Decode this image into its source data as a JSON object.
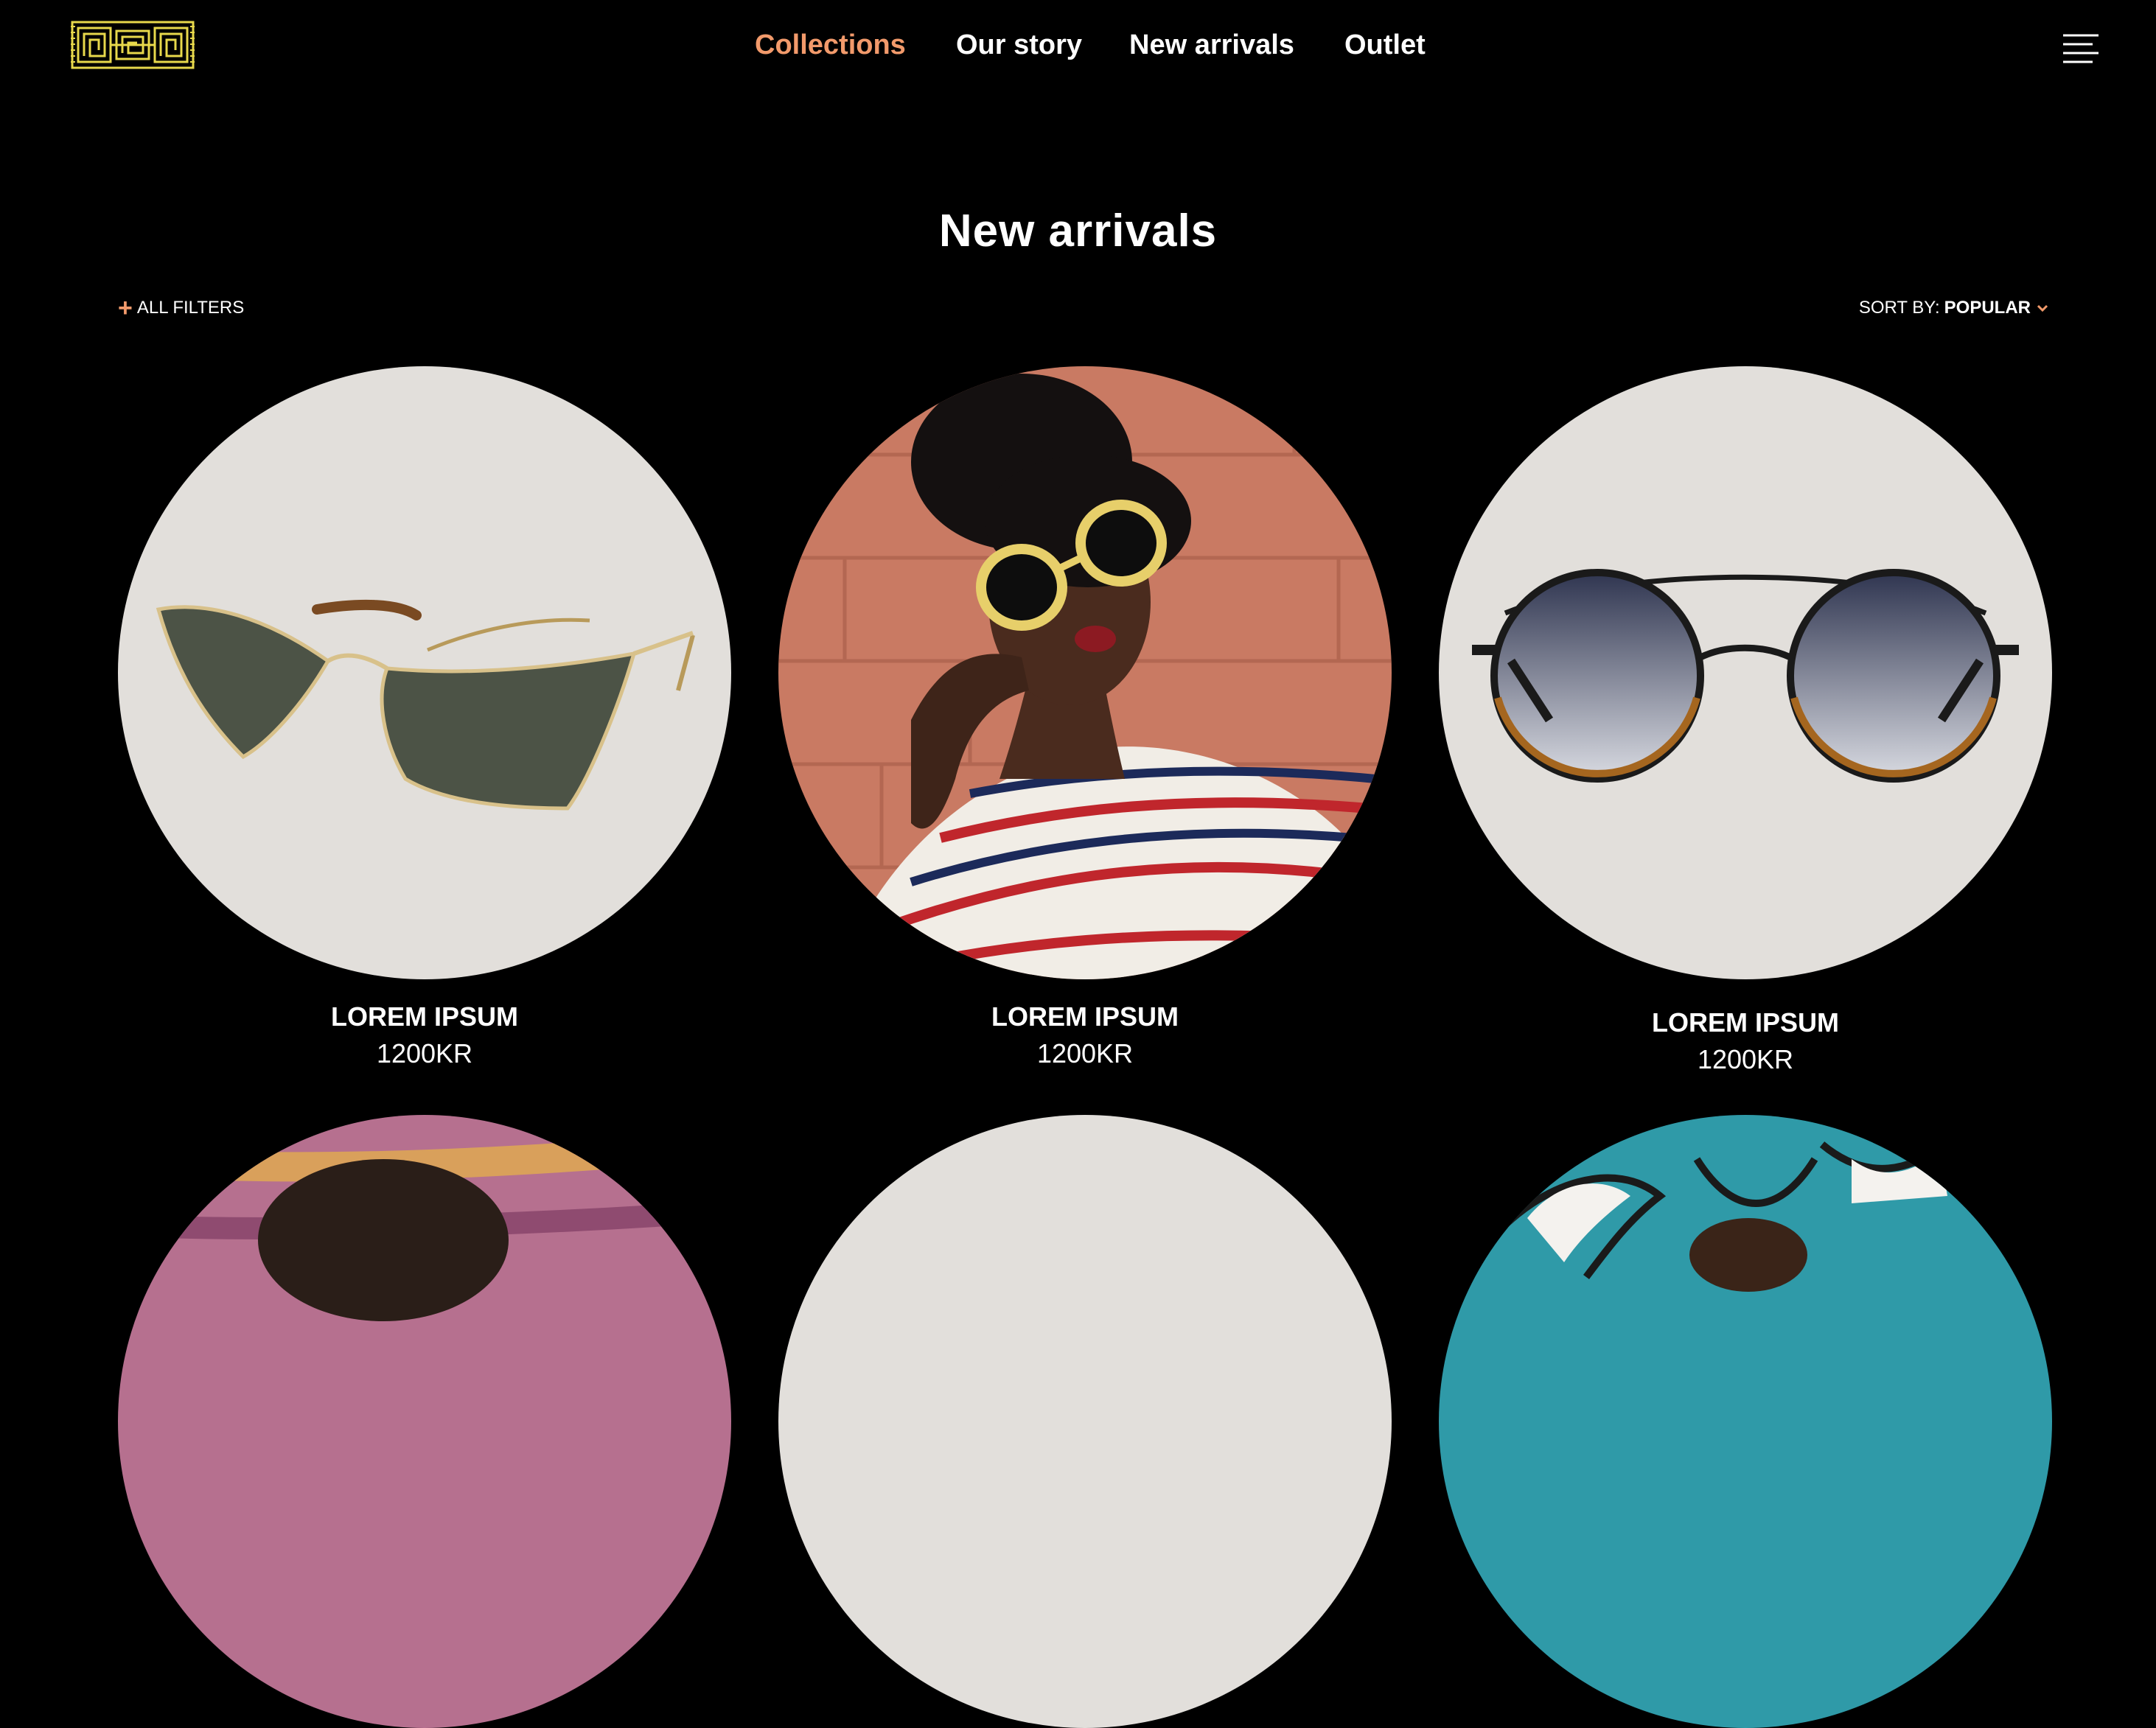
{
  "header": {
    "logo_icon": "greek-key-logo-icon",
    "nav": [
      "Collections",
      "Our story",
      "New arrivals",
      "Outlet"
    ],
    "active_nav": "Collections",
    "menu_icon": "hamburger-menu-icon"
  },
  "colors": {
    "accent": "#f29a6b",
    "logo": "#e7d84b",
    "background": "#000000",
    "product_bg": "#e2dfdb"
  },
  "page": {
    "title": "New arrivals"
  },
  "toolbar": {
    "filters_label": "ALL FILTERS",
    "sort_label": "SORT BY:",
    "sort_value": "POPULAR"
  },
  "products": [
    {
      "name": "LOREM IPSUM",
      "price": "1200KR"
    },
    {
      "name": "LOREM IPSUM",
      "price": "1200KR"
    },
    {
      "name": "LOREM IPSUM",
      "price": "1200KR"
    }
  ]
}
